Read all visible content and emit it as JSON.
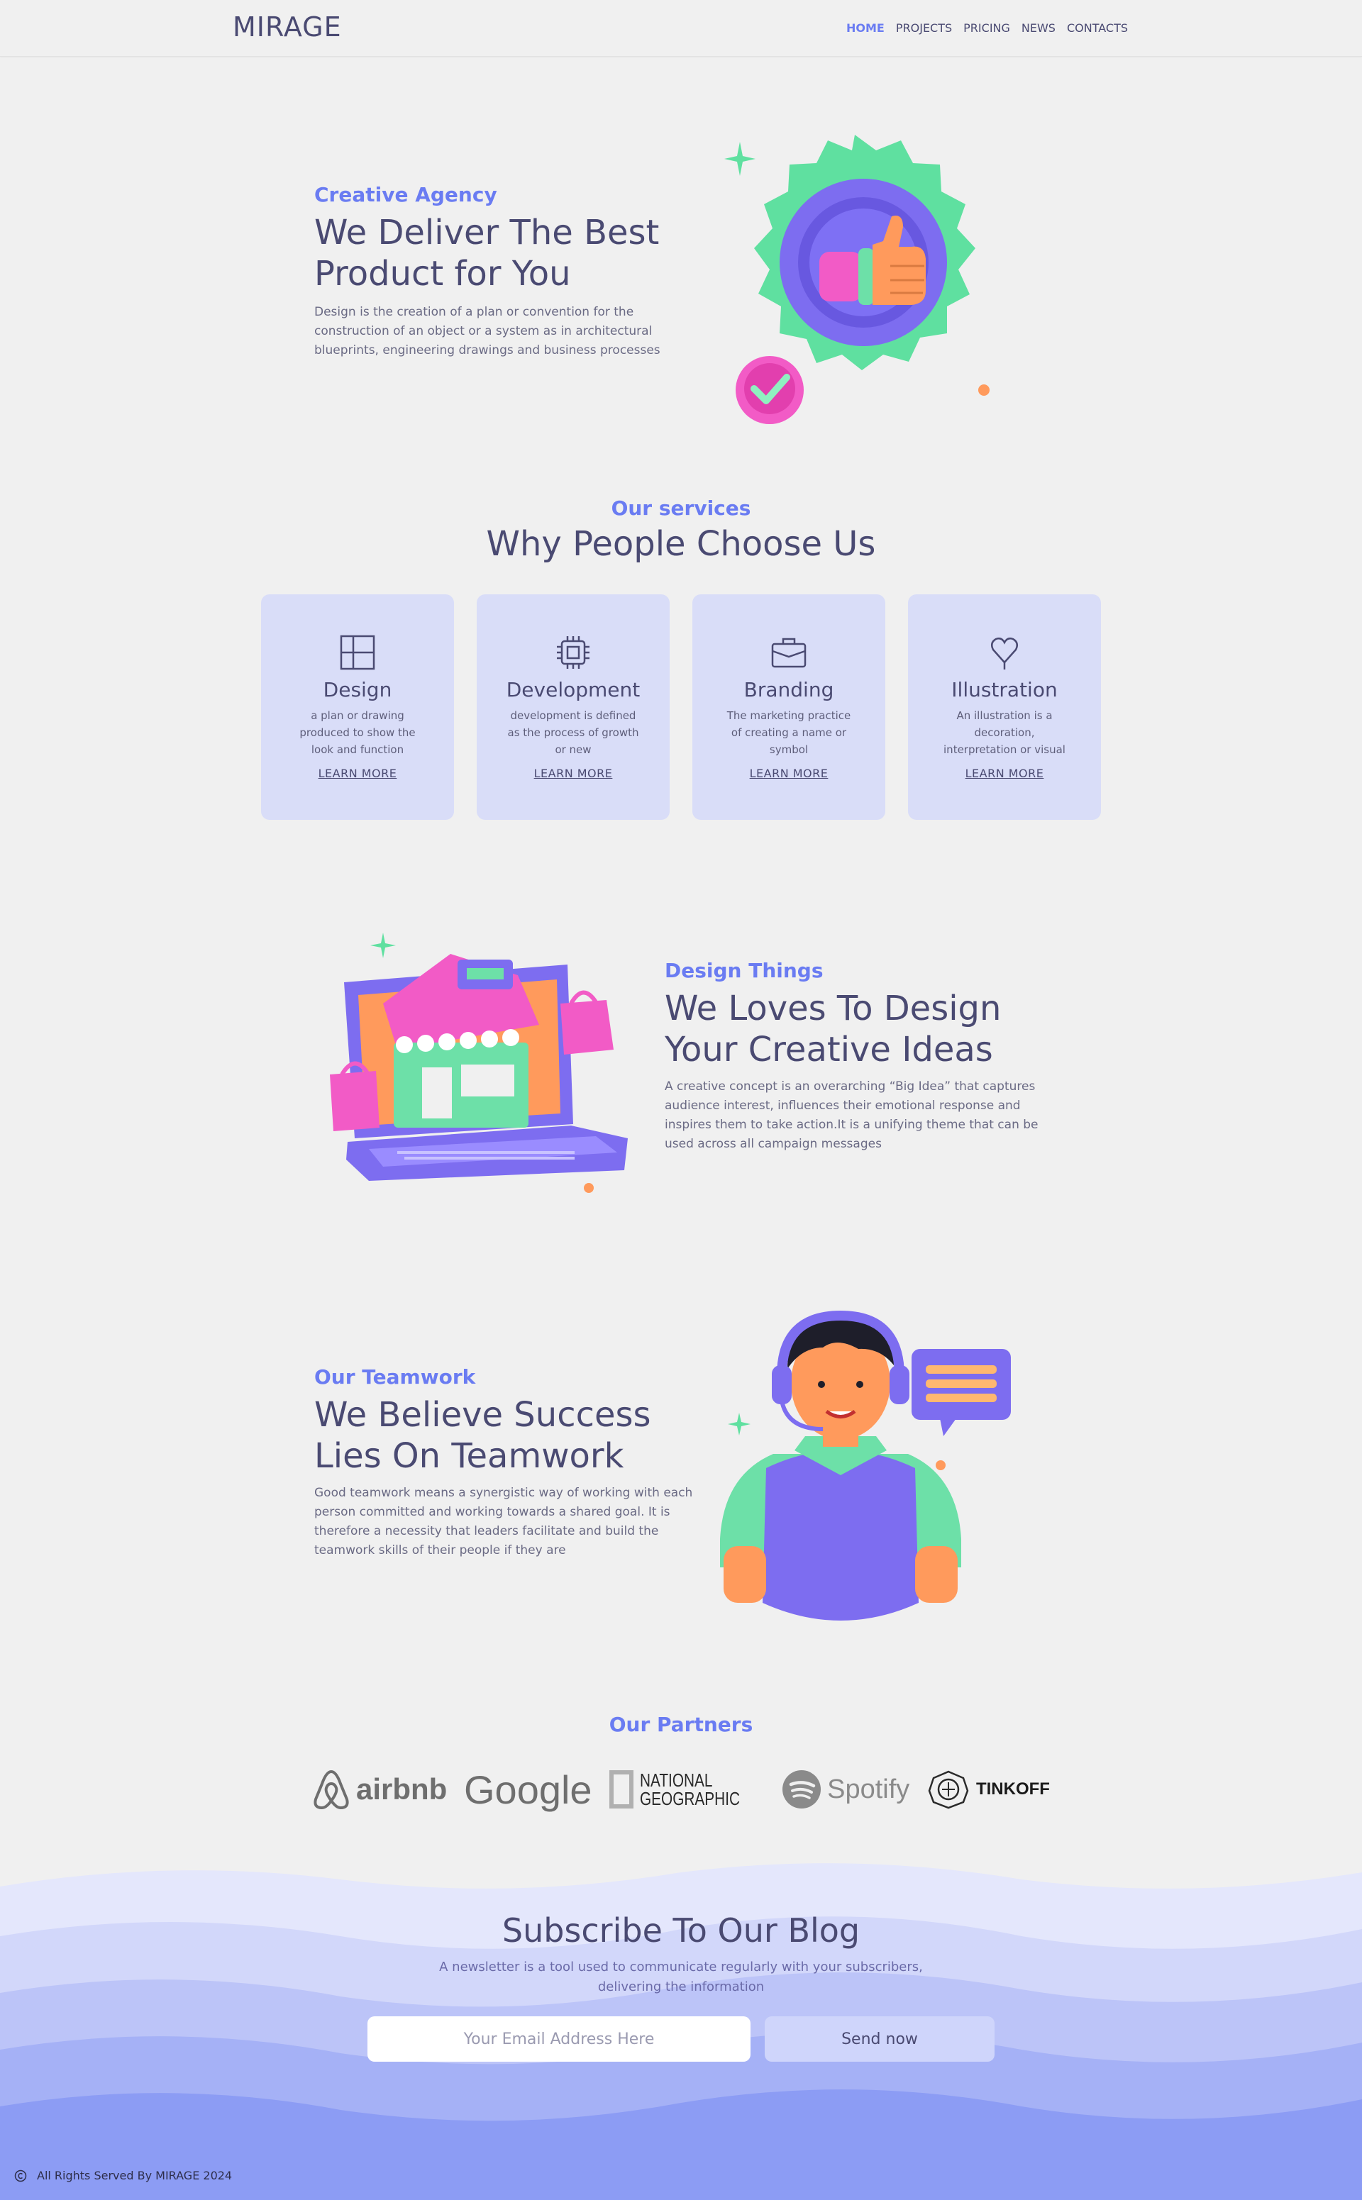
{
  "brand": "MIRAGE",
  "nav": [
    {
      "label": "HOME",
      "active": true
    },
    {
      "label": "PROJECTS",
      "active": false
    },
    {
      "label": "PRICING",
      "active": false
    },
    {
      "label": "NEWS",
      "active": false
    },
    {
      "label": "CONTACTS",
      "active": false
    }
  ],
  "hero": {
    "eyebrow": "Creative Agency",
    "title_line1": "We Deliver The Best",
    "title_line2": "Product for You",
    "text": "Design is the creation of a plan or convention for the construction of an object or a system as in architectural blueprints, engineering drawings and business processes",
    "image_icon": "thumbs-up-badge-illustration"
  },
  "services": {
    "eyebrow": "Our services",
    "title": "Why People Choose Us",
    "cards": [
      {
        "icon": "layout-icon",
        "title": "Design",
        "desc": "a plan or drawing produced to show the look and function",
        "link": "LEARN MORE"
      },
      {
        "icon": "chip-icon",
        "title": "Development",
        "desc": "development is defined as the process of growth or new",
        "link": "LEARN MORE"
      },
      {
        "icon": "briefcase-icon",
        "title": "Branding",
        "desc": "The marketing practice of creating a name or symbol",
        "link": "LEARN MORE"
      },
      {
        "icon": "heart-pin-icon",
        "title": "Illustration",
        "desc": "An illustration is a decoration, interpretation or visual",
        "link": "LEARN MORE"
      }
    ]
  },
  "design": {
    "eyebrow": "Design Things",
    "title_line1": "We Loves To Design",
    "title_line2": "Your Creative Ideas",
    "text": "A creative concept is an overarching “Big Idea” that captures audience interest, influences their emotional response and inspires them to take action.It is a unifying theme that can be used across all campaign messages",
    "image_icon": "laptop-shop-illustration"
  },
  "team": {
    "eyebrow": "Our Teamwork",
    "title_line1": "We Believe Success",
    "title_line2": "Lies On Teamwork",
    "text": "Good teamwork means a synergistic way of working with each person committed and working towards a shared goal. It is therefore a necessity that leaders facilitate and build the teamwork skills of their people if they are",
    "image_icon": "support-agent-illustration"
  },
  "partners": {
    "title": "Our Partners",
    "logos": [
      {
        "name": "airbnb",
        "icon": "airbnb-logo"
      },
      {
        "name": "Google",
        "icon": "google-logo"
      },
      {
        "name": "NATIONAL",
        "name2": "GEOGRAPHIC",
        "icon": "national-geographic-logo"
      },
      {
        "name": "Spotify",
        "icon": "spotify-logo"
      },
      {
        "name": "TINKOFF",
        "icon": "tinkoff-logo"
      }
    ]
  },
  "subscribe": {
    "title": "Subscribe To Our Blog",
    "text_line1": "A newsletter is a tool used to communicate regularly with your subscribers,",
    "text_line2": "delivering the information",
    "placeholder": "Your Email Address Here",
    "button": "Send now"
  },
  "footer": {
    "icon": "copyright-icon",
    "text": "All Rights Served By MIRAGE 2024"
  },
  "colors": {
    "accent": "#6a7cf2",
    "heading": "#4a4a72",
    "card_bg": "#d9ddf8",
    "page_bg": "#f0f0f0"
  }
}
